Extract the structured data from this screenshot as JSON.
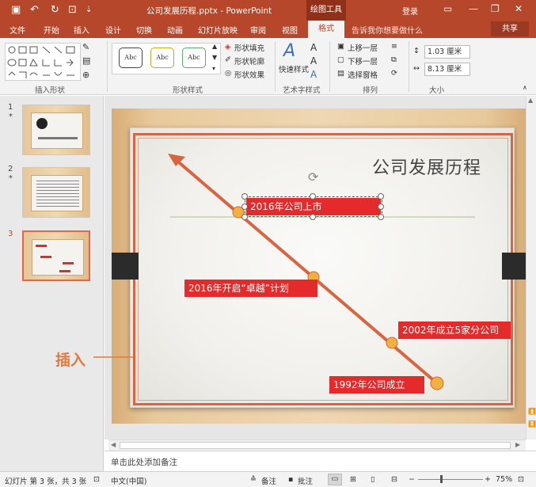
{
  "titlebar": {
    "doc_title": "公司发展历程.pptx - PowerPoint",
    "tool_tab": "绘图工具",
    "login": "登录",
    "save_icon": "▣",
    "undo_icon": "↶",
    "redo_icon": "↻",
    "present_icon": "⊡",
    "customize_icon": "⇣",
    "minimize_icon": "—",
    "restore_icon": "❐",
    "close_icon": "✕",
    "ribbon_display_icon": "▭"
  },
  "tabs": {
    "items": [
      "文件",
      "开始",
      "插入",
      "设计",
      "切换",
      "动画",
      "幻灯片放映",
      "审阅",
      "视图"
    ],
    "active": "格式",
    "tell_me": "告诉我你想要做什么",
    "share": "共享"
  },
  "ribbon": {
    "insert_shapes_label": "插入形状",
    "shape_styles_label": "形状样式",
    "style_sample": "Abc",
    "shape_fill": "形状填充",
    "shape_outline": "形状轮廓",
    "shape_effects": "形状效果",
    "art_styles_label": "艺术字样式",
    "quick_styles": "快速样式",
    "arrange_label": "排列",
    "bring_forward": "上移一层",
    "send_backward": "下移一层",
    "selection_pane": "选择窗格",
    "size_label": "大小",
    "height": "1.03 厘米",
    "width": "8.13 厘米"
  },
  "thumbnails": [
    {
      "num": "1",
      "star": "*"
    },
    {
      "num": "2",
      "star": "*"
    },
    {
      "num": "3",
      "star": ""
    }
  ],
  "slide": {
    "title": "公司发展历程",
    "labels": [
      "2016年公司上市",
      "2016年开启“卓越”计划",
      "2002年成立5家分公司",
      "1992年公司成立"
    ]
  },
  "callout": "插入",
  "notes_placeholder": "单击此处添加备注",
  "status": {
    "slide_info": "幻灯片 第 3 张，共 3 张",
    "language": "中文(中国)",
    "notes": "备注",
    "comments": "批注",
    "zoom": "75%"
  },
  "colors": {
    "accent": "#b7472a",
    "timeline": "#d9643f",
    "label_red": "#e42a2a",
    "dot": "#f0b23c"
  }
}
